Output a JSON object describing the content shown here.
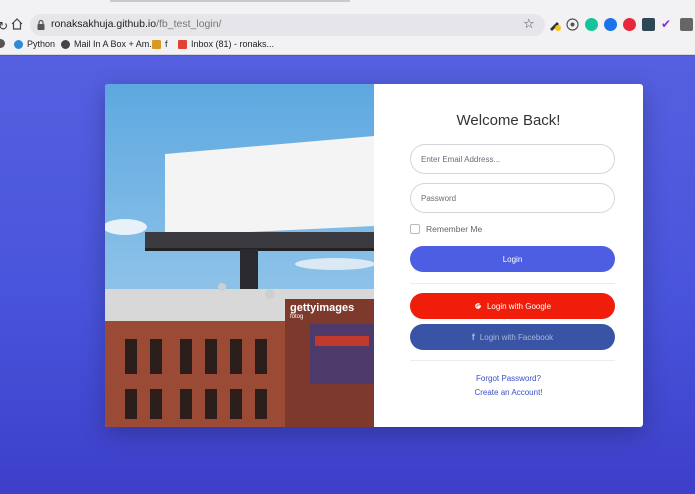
{
  "browser": {
    "url_host": "ronaksakhuja.github.io",
    "url_path": "/fb_test_login/",
    "bookmarks": [
      {
        "label": "Python",
        "icon": "python-icon"
      },
      {
        "label": "Mail In A Box + Am...",
        "icon": "globe-icon"
      },
      {
        "label": "f",
        "icon": "crown-icon"
      },
      {
        "label": "Inbox (81) - ronaks...",
        "icon": "gmail-icon"
      }
    ],
    "extensions": [
      "pen-icon",
      "tab-icon",
      "grammarly-icon",
      "vpn-icon",
      "adblock-icon",
      "wallet-icon",
      "check-icon",
      "menu-icon"
    ]
  },
  "login": {
    "title": "Welcome Back!",
    "email_placeholder": "Enter Email Address...",
    "password_placeholder": "Password",
    "remember_label": "Remember Me",
    "login_label": "Login",
    "google_label": "Login with Google",
    "facebook_label": "Login with Facebook",
    "forgot_label": "Forgot Password?",
    "create_label": "Create an Account!"
  },
  "photo": {
    "watermark_brand": "gettyimages",
    "watermark_credit": "fotog"
  },
  "colors": {
    "page_bg": "#4a56d8",
    "login_button": "#4e5ee3",
    "google_button": "#f01d0a",
    "facebook_button": "#3a54a5",
    "link": "#3b4fc8"
  }
}
